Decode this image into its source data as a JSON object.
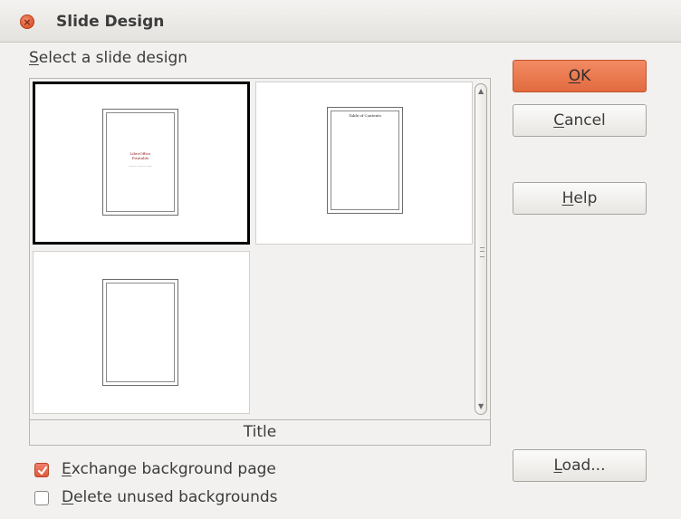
{
  "window": {
    "title": "Slide Design"
  },
  "select_label": {
    "pre": "",
    "mnemonic": "S",
    "post": "elect a slide design"
  },
  "designs": [
    {
      "thumbnail_title": "LibreOffice\nPrintable",
      "thumbnail_subtitle": "——— ——— ——"
    },
    {
      "thumbnail_title": "Table of Contents"
    },
    {}
  ],
  "selected_caption": "Title",
  "options": {
    "exchange": {
      "mnemonic": "E",
      "rest": "xchange background page",
      "checked": true
    },
    "delete": {
      "mnemonic": "D",
      "rest": "elete unused backgrounds",
      "checked": false
    }
  },
  "buttons": {
    "ok": {
      "mnemonic": "O",
      "rest": "K"
    },
    "cancel": {
      "mnemonic": "C",
      "rest": "ancel"
    },
    "help": {
      "mnemonic": "H",
      "rest": "elp"
    },
    "load": {
      "mnemonic": "L",
      "rest": "oad..."
    }
  },
  "colors": {
    "accent": "#e26b3f",
    "close": "#d9532d",
    "background": "#f2f1f0"
  }
}
